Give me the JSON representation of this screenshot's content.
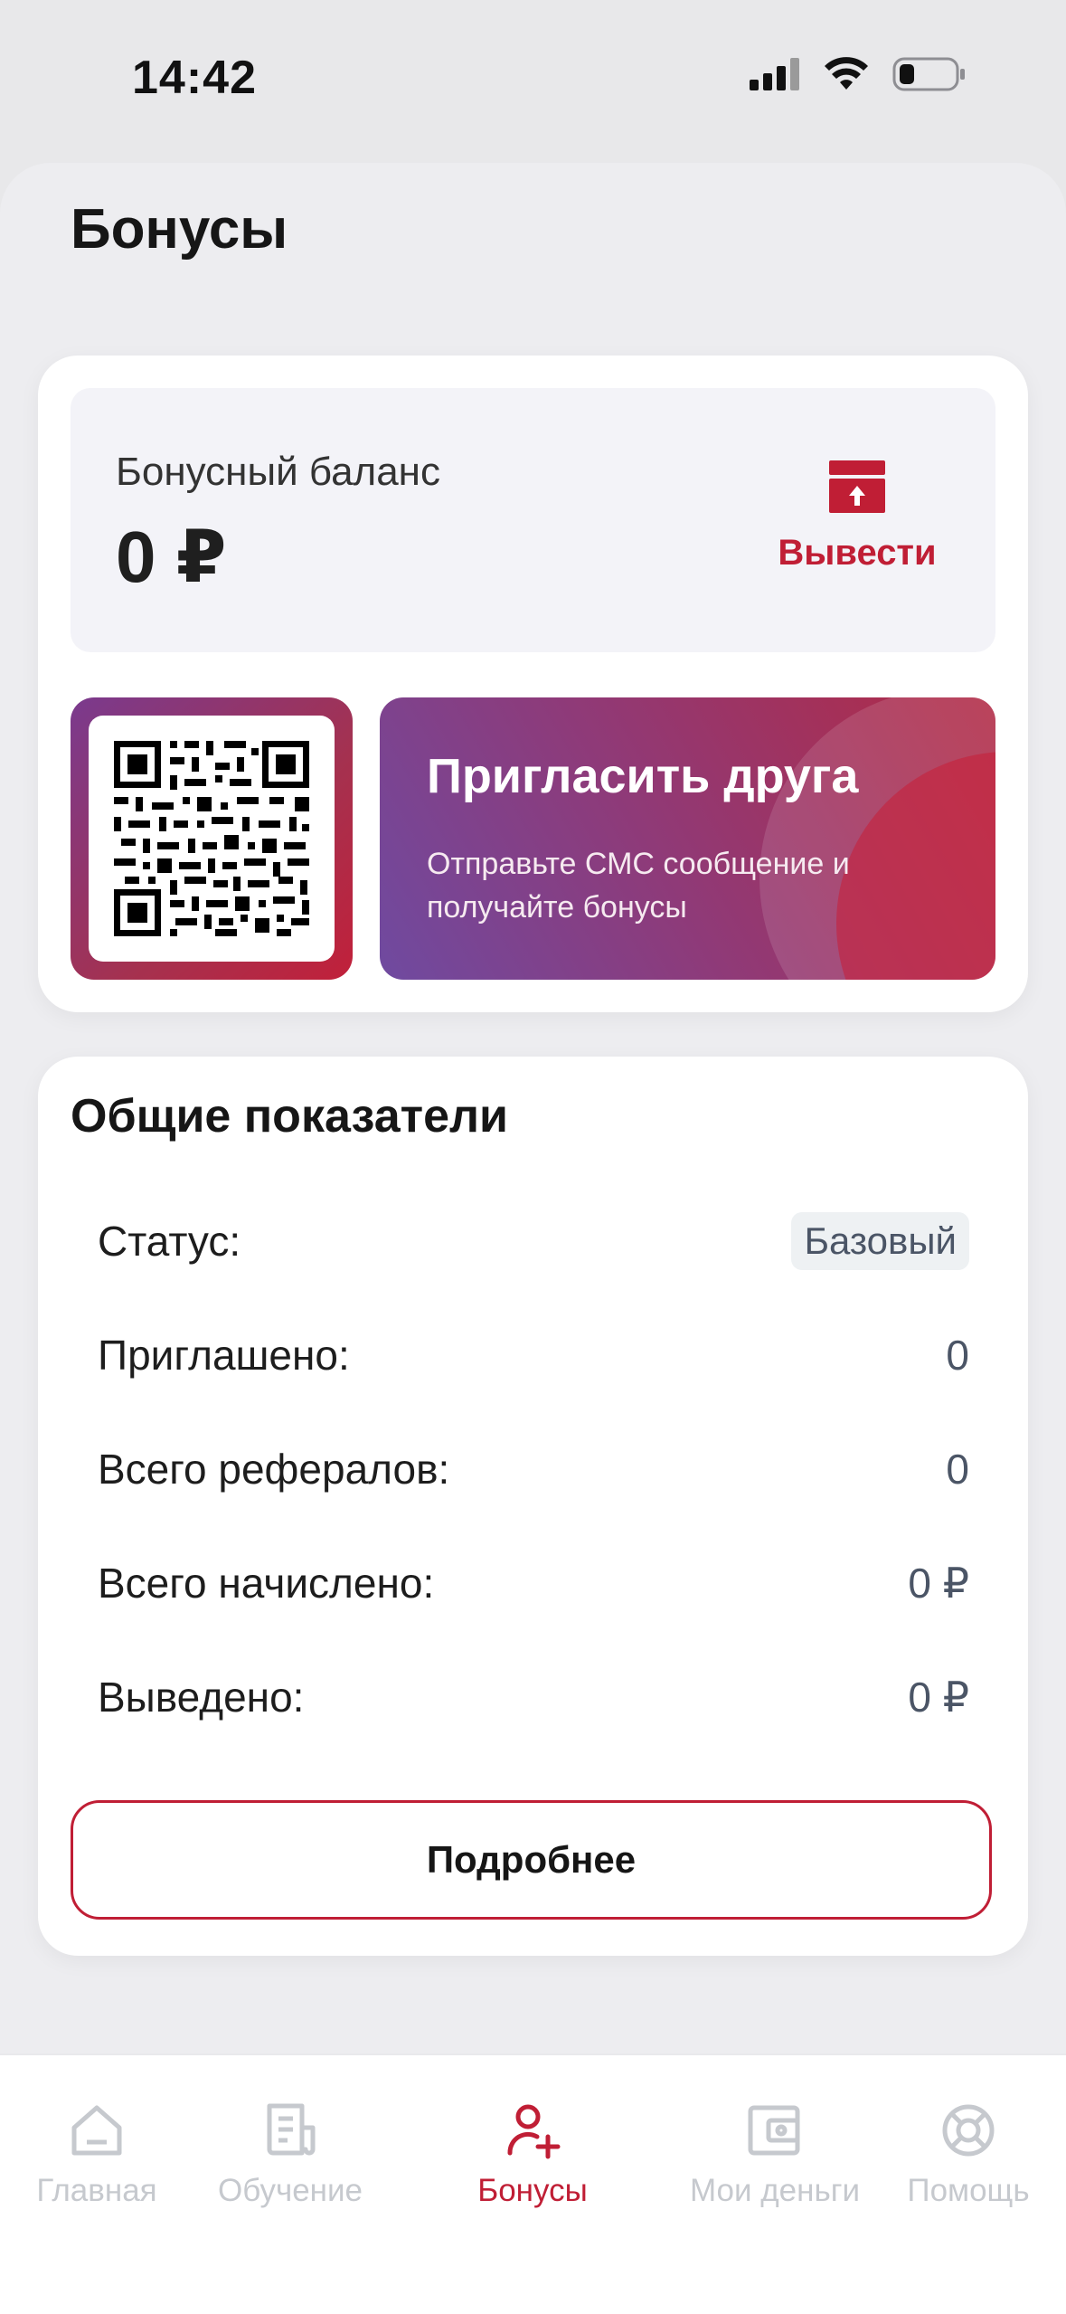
{
  "status_bar": {
    "time": "14:42"
  },
  "page": {
    "title": "Бонусы"
  },
  "balance": {
    "label": "Бонусный баланс",
    "value": "0 ₽",
    "withdraw_label": "Вывести"
  },
  "invite": {
    "title": "Пригласить друга",
    "subtitle": "Отправьте СМС сообщение и получайте бонусы"
  },
  "stats": {
    "title": "Общие показатели",
    "rows": [
      {
        "label": "Статус:",
        "value": "Базовый"
      },
      {
        "label": "Приглашено:",
        "value": "0"
      },
      {
        "label": "Всего рефералов:",
        "value": "0"
      },
      {
        "label": "Всего начислено:",
        "value": "0 ₽"
      },
      {
        "label": "Выведено:",
        "value": "0 ₽"
      }
    ],
    "details_label": "Подробнее"
  },
  "tabs": [
    {
      "label": "Главная",
      "icon": "home-icon",
      "active": false
    },
    {
      "label": "Обучение",
      "icon": "document-icon",
      "active": false
    },
    {
      "label": "Бонусы",
      "icon": "add-user-icon",
      "active": true
    },
    {
      "label": "Мои деньги",
      "icon": "wallet-icon",
      "active": false
    },
    {
      "label": "Помощь",
      "icon": "lifebuoy-icon",
      "active": false
    }
  ],
  "colors": {
    "accent": "#c01e35",
    "inactive_tab": "#c6c9ce",
    "background": "#ededf0"
  }
}
